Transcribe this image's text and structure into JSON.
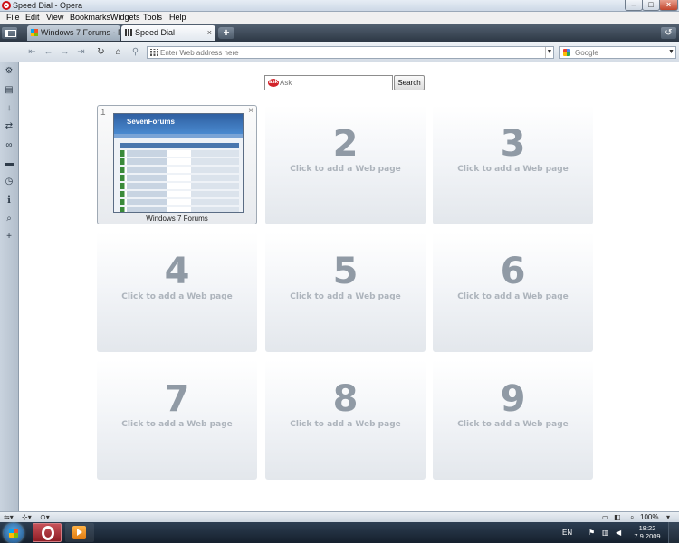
{
  "window": {
    "title": "Speed Dial - Opera"
  },
  "menu": [
    "File",
    "Edit",
    "View",
    "Bookmarks",
    "Widgets",
    "Tools",
    "Help"
  ],
  "tabs": [
    {
      "label": "Windows 7 Forums - P...",
      "active": false
    },
    {
      "label": "Speed Dial",
      "active": true
    }
  ],
  "address_bar": {
    "placeholder": "Enter Web address here"
  },
  "search_box": {
    "engine": "Google"
  },
  "ask_search": {
    "placeholder": "Ask",
    "button": "Search",
    "logo": "ask"
  },
  "speed_dial": {
    "empty_hint": "Click to add a Web page",
    "slots": [
      {
        "number": "1",
        "title": "Windows 7 Forums",
        "filled": true
      },
      {
        "number": "2",
        "filled": false
      },
      {
        "number": "3",
        "filled": false
      },
      {
        "number": "4",
        "filled": false
      },
      {
        "number": "5",
        "filled": false
      },
      {
        "number": "6",
        "filled": false
      },
      {
        "number": "7",
        "filled": false
      },
      {
        "number": "8",
        "filled": false
      },
      {
        "number": "9",
        "filled": false
      }
    ],
    "thumbnail_logo": "SevenForums"
  },
  "status_bar": {
    "zoom": "100%"
  },
  "taskbar": {
    "language": "EN",
    "time": "18:22",
    "date": "7.9.2009 г."
  },
  "colors": {
    "opera_red": "#cc0f16",
    "tabbar": "#2d3845",
    "dial_number": "#909aa5"
  }
}
